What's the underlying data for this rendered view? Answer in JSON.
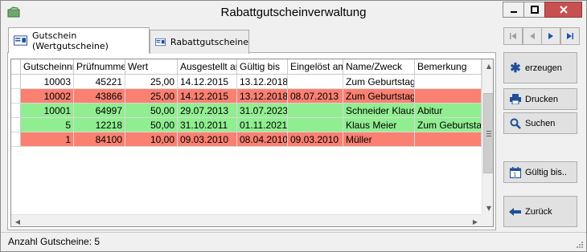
{
  "window": {
    "title": "Rabattgutscheinverwaltung",
    "close_color": "#c75050"
  },
  "tabs": [
    {
      "label": "Gutschein (Wertgutscheine)",
      "active": true
    },
    {
      "label": "Rabattgutscheine",
      "active": false
    }
  ],
  "table": {
    "columns": [
      "Gutscheinnr.",
      "Prüfnummer",
      "Wert",
      "Ausgestellt am",
      "Gültig bis",
      "Eingelöst am",
      "Name/Zweck",
      "Bemerkung"
    ],
    "rows": [
      {
        "status": "none",
        "cells": [
          "10003",
          "45221",
          "25,00",
          "14.12.2015",
          "13.12.2018",
          "",
          "Zum Geburtstag",
          ""
        ]
      },
      {
        "status": "red",
        "cells": [
          "10002",
          "43866",
          "25,00",
          "14.12.2015",
          "13.12.2018",
          "08.07.2013",
          "Zum Geburtstag",
          ""
        ]
      },
      {
        "status": "green",
        "cells": [
          "10001",
          "64997",
          "50,00",
          "29.07.2013",
          "31.07.2023",
          "",
          "Schneider Klaus",
          "Abitur"
        ]
      },
      {
        "status": "green",
        "cells": [
          "5",
          "12218",
          "50,00",
          "31.10.2011",
          "01.11.2021",
          "",
          "Klaus Meier",
          "Zum Geburtstag"
        ]
      },
      {
        "status": "red",
        "cells": [
          "1",
          "84100",
          "10,00",
          "09.03.2010",
          "08.04.2010",
          "09.03.2010",
          "Müller",
          ""
        ]
      }
    ],
    "status_colors": {
      "red": "#fa8072",
      "green": "#90ee90"
    }
  },
  "nav": [
    {
      "icon": "first-record-icon"
    },
    {
      "icon": "previous-record-icon"
    },
    {
      "icon": "next-record-icon"
    },
    {
      "icon": "last-record-icon"
    }
  ],
  "actions": {
    "create": "erzeugen",
    "print": "Drucken",
    "search": "Suchen",
    "valid_until": "Gültig bis..",
    "back": "Zurück"
  },
  "status": {
    "count_text": "Anzahl Gutscheine: 5"
  }
}
